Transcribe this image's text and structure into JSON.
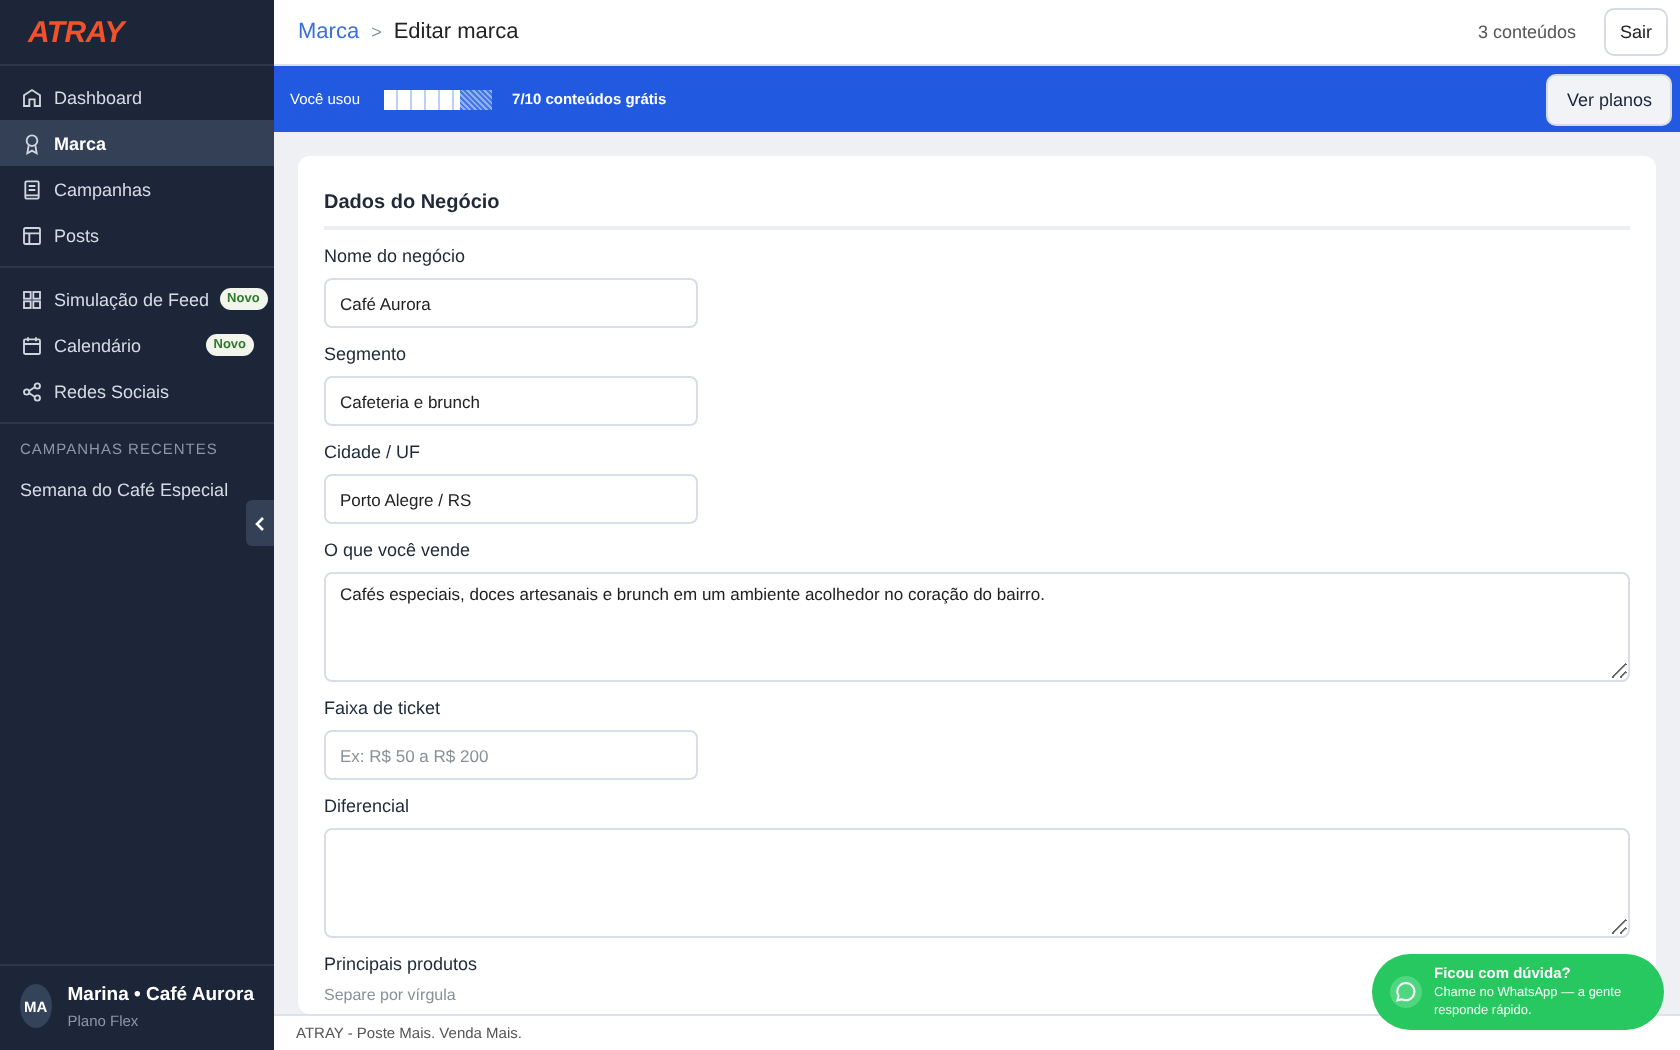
{
  "brand": {
    "logo": "ATRAY"
  },
  "sidebar": {
    "groups": [
      {
        "items": [
          {
            "label": "Dashboard",
            "selected": false
          },
          {
            "label": "Marca",
            "selected": true
          },
          {
            "label": "Campanhas",
            "selected": false
          },
          {
            "label": "Posts",
            "selected": false
          }
        ]
      },
      {
        "items": [
          {
            "label": "Simulação de Feed",
            "selected": false,
            "badge": "Novo"
          },
          {
            "label": "Calendário",
            "selected": false,
            "badge": "Novo"
          },
          {
            "label": "Redes Sociais",
            "selected": false
          }
        ]
      }
    ],
    "recent": {
      "heading": "CAMPANHAS RECENTES",
      "items": [
        "Semana do Café Especial"
      ]
    },
    "user": {
      "initials": "MA",
      "name": "Marina • Café Aurora",
      "plan": "Plano Flex"
    }
  },
  "breadcrumb": {
    "separator": ">",
    "items": [
      {
        "label": "Marca",
        "kind": "link"
      },
      {
        "label": "Editar marca",
        "kind": "current"
      }
    ]
  },
  "top_actions": {
    "count": "3 conteúdos",
    "button": "Sair"
  },
  "usage_banner": {
    "prefix": "Você usou",
    "level": 0.7,
    "reading": "7/10 conteúdos grátis",
    "button": "Ver planos"
  },
  "form": {
    "title": "Dados do Negócio",
    "fields": [
      {
        "label": "Nome do negócio",
        "kind": "input",
        "value": "Café Aurora"
      },
      {
        "label": "Segmento",
        "kind": "input",
        "value": "Cafeteria e brunch"
      },
      {
        "label": "Cidade / UF",
        "kind": "input",
        "value": "Porto Alegre / RS"
      },
      {
        "label": "O que você vende",
        "kind": "textarea",
        "value": "Cafés especiais, doces artesanais e brunch em um ambiente acolhedor no coração do bairro."
      },
      {
        "label": "Faixa de ticket",
        "kind": "input",
        "placeholder": "Ex: R$ 50 a R$ 200"
      },
      {
        "label": "Diferencial",
        "kind": "textarea"
      },
      {
        "label": "Principais produtos",
        "kind": "hint-only",
        "hint": "Separe por vírgula"
      }
    ]
  },
  "footer": "ATRAY - Poste Mais. Venda Mais.",
  "help_bubble": {
    "title": "Ficou com dúvida?",
    "text": "Chame no WhatsApp — a gente responde rápido."
  }
}
